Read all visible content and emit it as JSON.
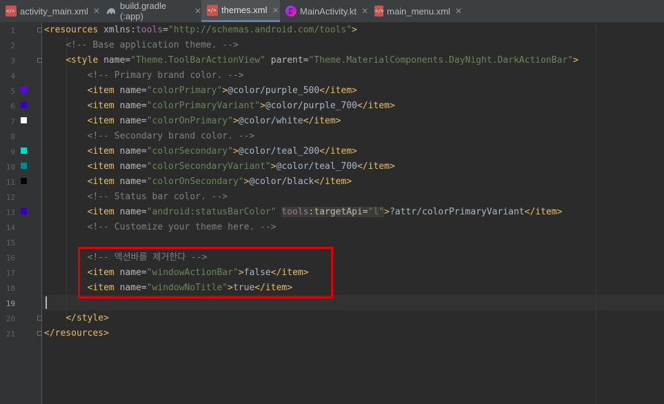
{
  "tabs": [
    {
      "label": "activity_main.xml",
      "icon": "xml-file-icon"
    },
    {
      "label": "build.gradle (:app)",
      "icon": "gradle-elephant-icon"
    },
    {
      "label": "themes.xml",
      "icon": "xml-file-icon",
      "active": true
    },
    {
      "label": "MainActivity.kt",
      "icon": "kotlin-file-icon"
    },
    {
      "label": "main_menu.xml",
      "icon": "xml-file-icon"
    }
  ],
  "colors": {
    "purple_500": "#6200ee",
    "purple_700": "#3700b3",
    "white": "#ffffff",
    "teal_200": "#03dac5",
    "teal_700": "#018786",
    "black": "#000000",
    "highlight_box": "#e00000"
  },
  "lines": {
    "l1": {
      "no": "1",
      "open": "<resources ",
      "attr": "xmlns:",
      "ns": "tools",
      "eq": "=",
      "val": "\"http://schemas.android.com/tools\"",
      "close": ">"
    },
    "l2": {
      "no": "2",
      "comment": "<!-- Base application theme. -->"
    },
    "l3": {
      "no": "3",
      "open": "<style ",
      "a1": "name",
      "eq1": "=",
      "v1": "\"Theme.ToolBarActionView\"",
      "a2": " parent",
      "eq2": "=",
      "v2": "\"Theme.MaterialComponents.DayNight.DarkActionBar\"",
      "close": ">"
    },
    "l4": {
      "no": "4",
      "comment": "<!-- Primary brand color. -->"
    },
    "l5": {
      "no": "5",
      "name": "\"colorPrimary\"",
      "text": "@color/purple_500"
    },
    "l6": {
      "no": "6",
      "name": "\"colorPrimaryVariant\"",
      "text": "@color/purple_700"
    },
    "l7": {
      "no": "7",
      "name": "\"colorOnPrimary\"",
      "text": "@color/white"
    },
    "l8": {
      "no": "8",
      "comment": "<!-- Secondary brand color. -->"
    },
    "l9": {
      "no": "9",
      "name": "\"colorSecondary\"",
      "text": "@color/teal_200"
    },
    "l10": {
      "no": "10",
      "name": "\"colorSecondaryVariant\"",
      "text": "@color/teal_700"
    },
    "l11": {
      "no": "11",
      "name": "\"colorOnSecondary\"",
      "text": "@color/black"
    },
    "l12": {
      "no": "12",
      "comment": "<!-- Status bar color. -->"
    },
    "l13": {
      "no": "13",
      "name": "\"android:statusBarColor\"",
      "ns": "tools",
      "attr2": ":targetApi",
      "eq2": "=",
      "v2": "\"l\"",
      "text": "?attr/colorPrimaryVariant"
    },
    "l14": {
      "no": "14",
      "comment": "<!-- Customize your theme here. -->"
    },
    "l15": {
      "no": "15"
    },
    "l16": {
      "no": "16",
      "comment": "<!-- 액션바를 제거한다 -->"
    },
    "l17": {
      "no": "17",
      "name": "\"windowActionBar\"",
      "text": "false"
    },
    "l18": {
      "no": "18",
      "name": "\"windowNoTitle\"",
      "text": "true"
    },
    "l19": {
      "no": "19"
    },
    "l20": {
      "no": "20",
      "close_tag": "</style>"
    },
    "l21": {
      "no": "21",
      "close_tag": "</resources>"
    }
  },
  "item_parts": {
    "open": "<item ",
    "attr": "name",
    "eq": "=",
    "gt": ">",
    "close": "</item>"
  }
}
